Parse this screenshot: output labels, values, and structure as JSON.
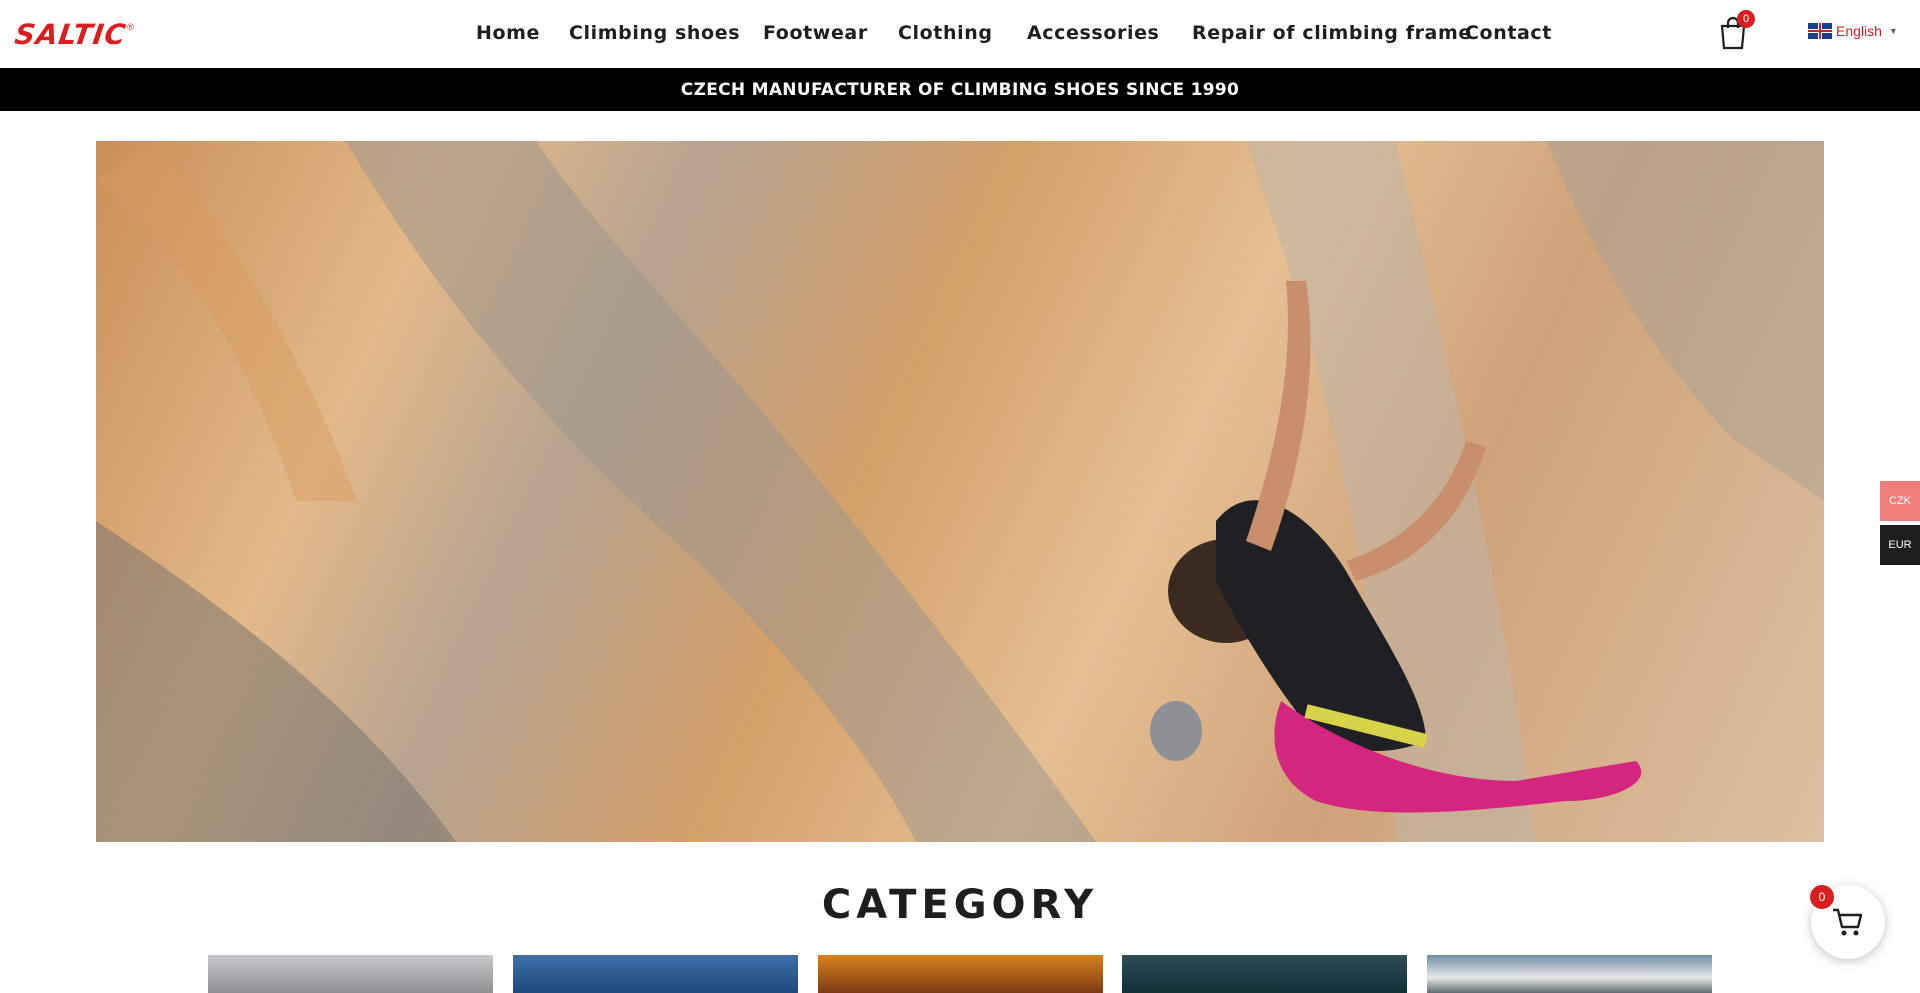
{
  "header": {
    "logo_text": "SALTIC",
    "logo_mark": "®",
    "nav": [
      {
        "label": "Home"
      },
      {
        "label": "Climbing shoes"
      },
      {
        "label": "Footwear"
      },
      {
        "label": "Clothing"
      },
      {
        "label": "Accessories"
      },
      {
        "label": "Repair of climbing frame"
      },
      {
        "label": "Contact"
      }
    ],
    "cart_count": "0",
    "language": "English",
    "language_caret": "▼"
  },
  "banner": {
    "text": "CZECH MANUFACTURER OF CLIMBING SHOES SINCE 1990"
  },
  "hero": {
    "image_alt_icon": "climber-photo"
  },
  "category": {
    "title": "CATEGORY"
  },
  "currency": {
    "options": [
      "CZK",
      "EUR"
    ]
  },
  "floating_cart": {
    "count": "0"
  },
  "colors": {
    "brand_red": "#d81e1e",
    "banner_bg": "#000000",
    "czk_bg": "#f07c7c",
    "eur_bg": "#1e1e1e"
  }
}
